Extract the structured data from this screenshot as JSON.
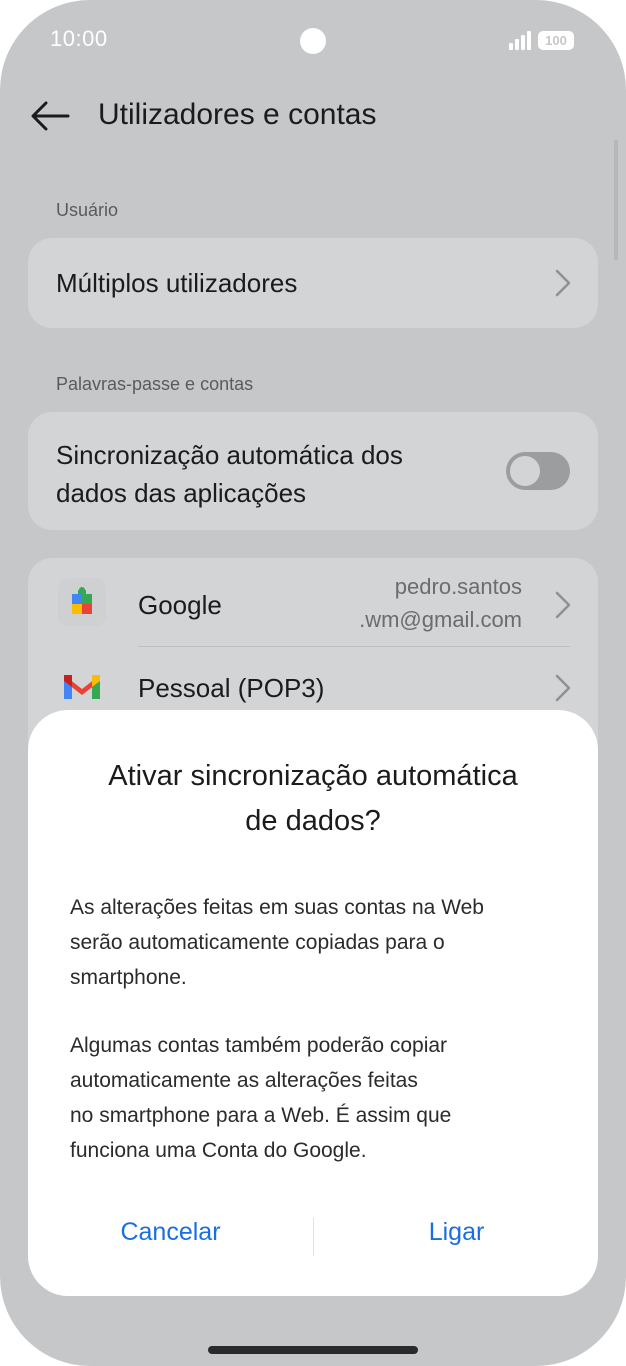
{
  "status_bar": {
    "time": "10:00",
    "battery": "100",
    "icons": [
      "signal-icon",
      "battery-icon"
    ]
  },
  "header": {
    "title": "Utilizadores e contas",
    "back_icon": "back-arrow-icon"
  },
  "sections": {
    "user_label": "Usuário",
    "multiple_users": "Múltiplos utilizadores",
    "passwords_label": "Palavras-passe e contas",
    "auto_sync_line1": "Sincronização automática dos",
    "auto_sync_line2": "dados das aplicações",
    "auto_sync_enabled": false
  },
  "accounts": [
    {
      "name": "Google",
      "email_line1": "pedro.santos",
      "email_line2": ".wm@gmail.com",
      "icon": "google-play-services-icon"
    },
    {
      "name": "Pessoal (POP3)",
      "icon": "gmail-icon"
    }
  ],
  "dialog": {
    "title_line1": "Ativar sincronização automática",
    "title_line2": "de dados?",
    "p1_line1": "As alterações feitas em suas contas na Web",
    "p1_line2": "serão automaticamente copiadas para o",
    "p1_line3": "smartphone.",
    "p2_line1": "Algumas contas também poderão copiar",
    "p2_line2": "automaticamente as alterações feitas",
    "p2_line3": "no smartphone para a Web. É assim que",
    "p2_line4": "funciona uma Conta do Google.",
    "cancel_label": "Cancelar",
    "confirm_label": "Ligar"
  },
  "colors": {
    "accent": "#1a6fe0",
    "background": "#c6c7c9",
    "card": "#d3d4d6"
  }
}
